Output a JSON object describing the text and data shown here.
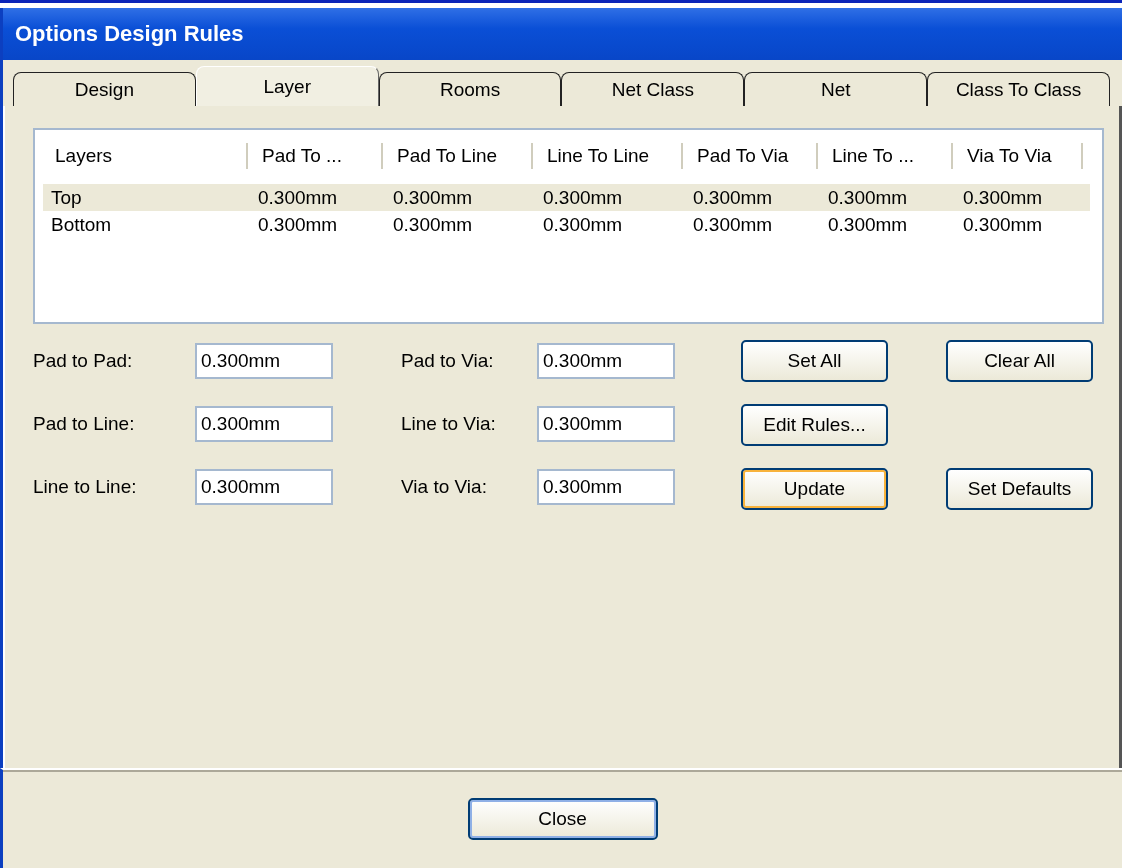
{
  "window": {
    "title": "Options Design Rules"
  },
  "tabs": [
    {
      "label": "Design",
      "selected": false
    },
    {
      "label": "Layer",
      "selected": true
    },
    {
      "label": "Rooms",
      "selected": false
    },
    {
      "label": "Net Class",
      "selected": false
    },
    {
      "label": "Net",
      "selected": false
    },
    {
      "label": "Class To Class",
      "selected": false
    }
  ],
  "table": {
    "columns": [
      "Layers",
      "Pad To ...",
      "Pad To Line",
      "Line To Line",
      "Pad To Via",
      "Line To ...",
      "Via To Via"
    ],
    "rows": [
      {
        "cells": [
          "Top",
          "0.300mm",
          "0.300mm",
          "0.300mm",
          "0.300mm",
          "0.300mm",
          "0.300mm"
        ],
        "selected": true
      },
      {
        "cells": [
          "Bottom",
          "0.300mm",
          "0.300mm",
          "0.300mm",
          "0.300mm",
          "0.300mm",
          "0.300mm"
        ],
        "selected": false
      }
    ]
  },
  "fields": [
    {
      "label": "Pad to Pad:",
      "value": "0.300mm"
    },
    {
      "label": "Pad to Via:",
      "value": "0.300mm"
    },
    {
      "label": "Pad to Line:",
      "value": "0.300mm"
    },
    {
      "label": "Line to Via:",
      "value": "0.300mm"
    },
    {
      "label": "Line to Line:",
      "value": "0.300mm"
    },
    {
      "label": "Via to Via:",
      "value": "0.300mm"
    }
  ],
  "buttons": [
    {
      "label": "Set All",
      "focused": false
    },
    {
      "label": "Clear All",
      "focused": false
    },
    {
      "label": "Edit Rules...",
      "focused": false
    },
    {
      "label": "Update",
      "focused": true
    },
    {
      "label": "Set Defaults",
      "focused": false
    }
  ],
  "close_button": {
    "label": "Close"
  }
}
